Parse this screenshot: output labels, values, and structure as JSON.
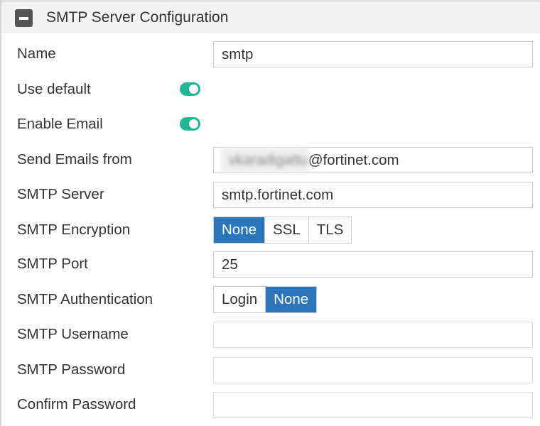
{
  "header": {
    "title": "SMTP Server Configuration"
  },
  "fields": {
    "name": {
      "label": "Name",
      "value": "smtp"
    },
    "use_default": {
      "label": "Use default",
      "enabled": true
    },
    "enable_email": {
      "label": "Enable Email",
      "enabled": true
    },
    "send_from": {
      "label": "Send Emails from",
      "value_redacted": "vkaradigattu",
      "value_domain": "@fortinet.com"
    },
    "smtp_server": {
      "label": "SMTP Server",
      "value": "smtp.fortinet.com"
    },
    "encryption": {
      "label": "SMTP Encryption",
      "options": [
        "None",
        "SSL",
        "TLS"
      ],
      "selected": "None"
    },
    "port": {
      "label": "SMTP Port",
      "value": "25"
    },
    "auth": {
      "label": "SMTP Authentication",
      "options": [
        "Login",
        "None"
      ],
      "selected": "None"
    },
    "username": {
      "label": "SMTP Username",
      "value": ""
    },
    "password": {
      "label": "SMTP Password",
      "value": ""
    },
    "confirm_password": {
      "label": "Confirm Password",
      "value": ""
    }
  },
  "colors": {
    "accent": "#2b75bb",
    "toggle": "#20b894"
  }
}
